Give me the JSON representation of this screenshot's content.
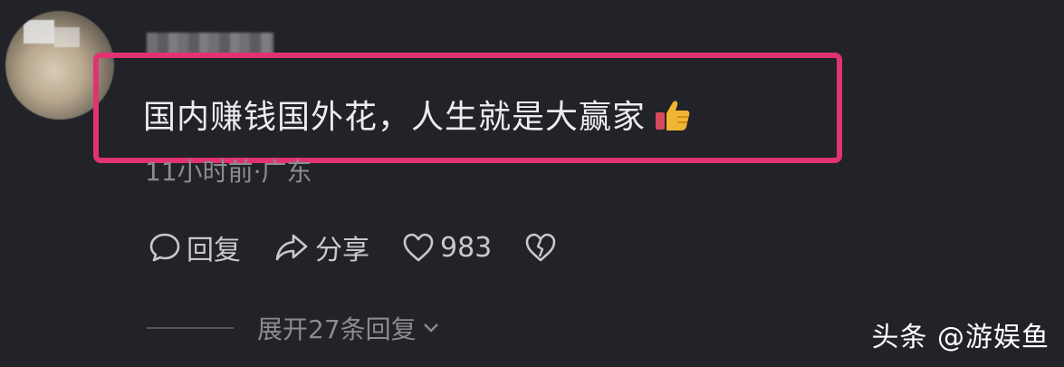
{
  "comment": {
    "text": "国内赚钱国外花，人生就是大赢家",
    "meta": "11小时前·广东",
    "emoji": "thumbs-up-icon"
  },
  "actions": {
    "reply_label": "回复",
    "share_label": "分享",
    "like_count": "983"
  },
  "replies": {
    "expand_label": "展开27条回复"
  },
  "watermark": {
    "text": "头条 @游娱鱼"
  },
  "colors": {
    "background": "#222229",
    "highlight_border": "#e0336f",
    "text_primary": "#ececee",
    "text_secondary": "#8b8b92"
  }
}
